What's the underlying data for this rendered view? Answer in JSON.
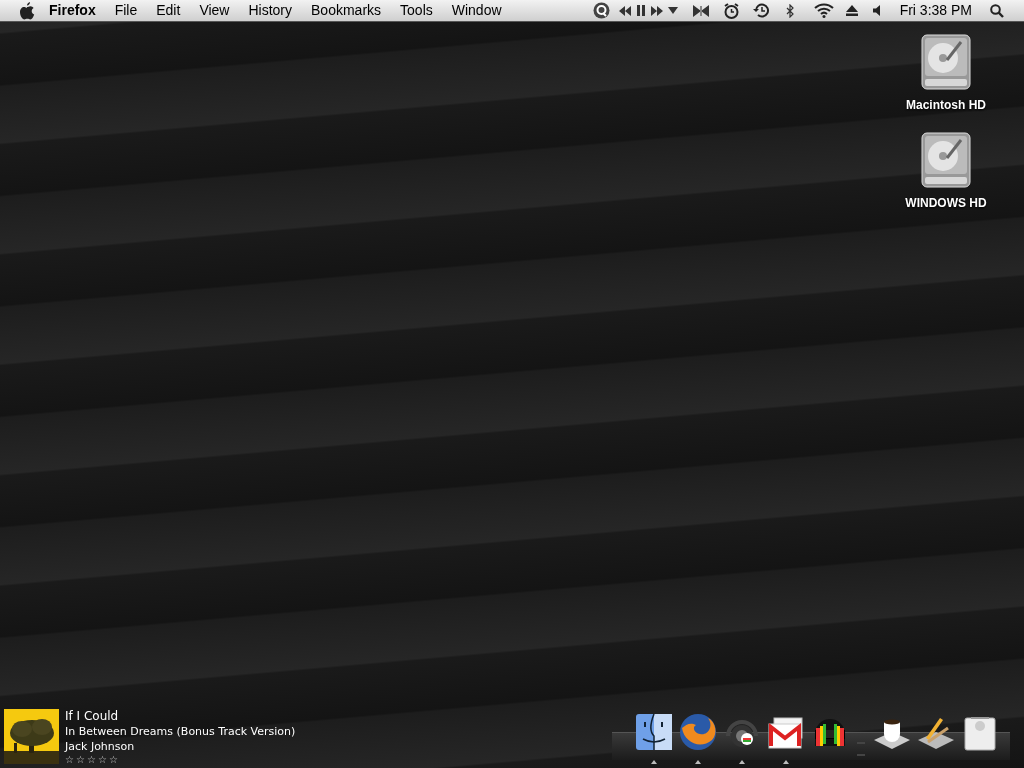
{
  "menu_bar": {
    "app_name": "Firefox",
    "menus": [
      "File",
      "Edit",
      "View",
      "History",
      "Bookmarks",
      "Tools",
      "Window"
    ],
    "clock": "Fri 3:38 PM"
  },
  "desktop_icons": [
    {
      "label": "Macintosh HD"
    },
    {
      "label": "WINDOWS HD"
    }
  ],
  "now_playing": {
    "title": "If I Could",
    "album": "In Between Dreams (Bonus Track Version)",
    "artist": "Jack Johnson",
    "stars": 0
  },
  "dock": [
    {
      "kind": "finder",
      "running": true
    },
    {
      "kind": "firefox",
      "running": true
    },
    {
      "kind": "itunes",
      "running": true
    },
    {
      "kind": "mail",
      "running": true
    },
    {
      "kind": "helmet",
      "running": false
    },
    {
      "kind": "separator"
    },
    {
      "kind": "coffee-stack",
      "running": false
    },
    {
      "kind": "tools-stack",
      "running": false
    },
    {
      "kind": "trash",
      "running": false
    }
  ]
}
